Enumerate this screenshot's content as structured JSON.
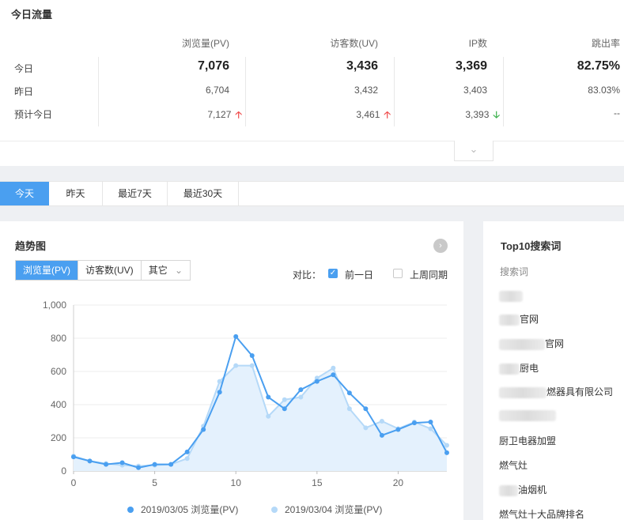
{
  "stats": {
    "title": "今日流量",
    "headers": [
      "浏览量(PV)",
      "访客数(UV)",
      "IP数",
      "跳出率"
    ],
    "rows": [
      {
        "label": "今日",
        "values": [
          "7,076",
          "3,436",
          "3,369",
          "82.75%"
        ]
      },
      {
        "label": "昨日",
        "values": [
          "6,704",
          "3,432",
          "3,403",
          "83.03%"
        ]
      },
      {
        "label": "预计今日",
        "values": [
          "7,127",
          "3,461",
          "3,393",
          "--"
        ],
        "arrows": [
          "up",
          "up",
          "down",
          ""
        ]
      }
    ],
    "arrow_up_color": "#f04e4e",
    "arrow_down_color": "#3fb24f"
  },
  "tabs": [
    "今天",
    "昨天",
    "最近7天",
    "最近30天"
  ],
  "trend": {
    "title": "趋势图",
    "metric_tabs": [
      "浏览量(PV)",
      "访客数(UV)",
      "其它"
    ],
    "compare_label": "对比：",
    "compare_options": [
      {
        "label": "前一日",
        "checked": true
      },
      {
        "label": "上周同期",
        "checked": false
      }
    ]
  },
  "chart_data": {
    "type": "area",
    "x": [
      0,
      1,
      2,
      3,
      4,
      5,
      6,
      7,
      8,
      9,
      10,
      11,
      12,
      13,
      14,
      15,
      16,
      17,
      18,
      19,
      20,
      21,
      22,
      23
    ],
    "xticks": [
      0,
      5,
      10,
      15,
      20
    ],
    "ylim": [
      0,
      1000
    ],
    "yticks": [
      "0",
      "200",
      "400",
      "600",
      "800",
      "1,000"
    ],
    "ytick_values": [
      0,
      200,
      400,
      600,
      800,
      1000
    ],
    "series": [
      {
        "name": "2019/03/05 浏览量(PV)",
        "color": "#4a9ff0",
        "values": [
          85,
          60,
          40,
          50,
          20,
          40,
          40,
          115,
          250,
          475,
          810,
          695,
          445,
          375,
          490,
          540,
          580,
          470,
          375,
          215,
          250,
          290,
          295,
          110
        ]
      },
      {
        "name": "2019/03/04 浏览量(PV)",
        "color": "#b5d9f8",
        "values": [
          90,
          60,
          45,
          35,
          30,
          35,
          40,
          75,
          270,
          540,
          635,
          635,
          330,
          430,
          445,
          560,
          620,
          375,
          260,
          300,
          255,
          295,
          255,
          155
        ]
      }
    ]
  },
  "top10": {
    "title": "Top10搜索词",
    "subtitle": "搜索词",
    "keywords": [
      "",
      "官网",
      "官网",
      "厨电",
      "燃器具有限公司",
      "",
      "厨卫电器加盟",
      "燃气灶",
      "油烟机",
      "燃气灶十大品牌排名"
    ]
  }
}
